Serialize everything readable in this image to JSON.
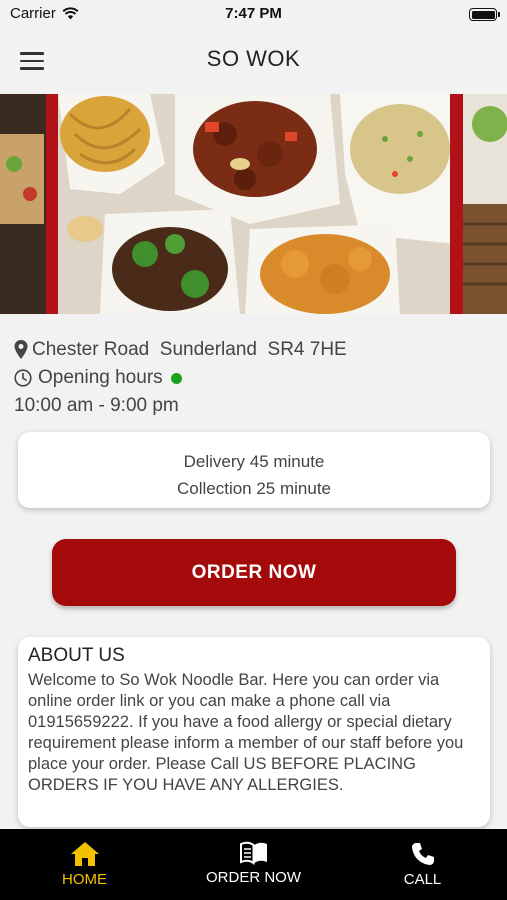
{
  "status_bar": {
    "carrier": "Carrier",
    "time": "7:47 PM"
  },
  "header": {
    "title": "SO WOK",
    "menu_icon": "hamburger-icon"
  },
  "hero": {
    "image": "chinese-takeaway-boxes"
  },
  "location": {
    "address": "Chester Road  Sunderland  SR4 7HE",
    "icon": "map-pin-icon"
  },
  "hours": {
    "label": "Opening hours",
    "times": "10:00 am - 9:00 pm",
    "status_color": "#1ca11c",
    "icon": "clock-icon"
  },
  "delivery": {
    "delivery_time": "Delivery 45 minute",
    "collection_time": "Collection 25 minute"
  },
  "order_button": {
    "label": "ORDER NOW",
    "color": "#a50a0a"
  },
  "about": {
    "title": "ABOUT US",
    "text": "Welcome to So Wok Noodle Bar. Here you can order via online order link or you can make a phone call via 01915659222.  If you have a food allergy or special dietary requirement please inform a member of our staff before you place your order. Please Call US BEFORE PLACING ORDERS IF YOU HAVE ANY ALLERGIES."
  },
  "tab_bar": {
    "active_color": "#f2c200",
    "items": [
      {
        "label": "HOME",
        "icon": "home-icon",
        "active": true
      },
      {
        "label": "ORDER NOW",
        "icon": "menu-book-icon",
        "active": false
      },
      {
        "label": "CALL",
        "icon": "phone-icon",
        "active": false
      }
    ]
  }
}
